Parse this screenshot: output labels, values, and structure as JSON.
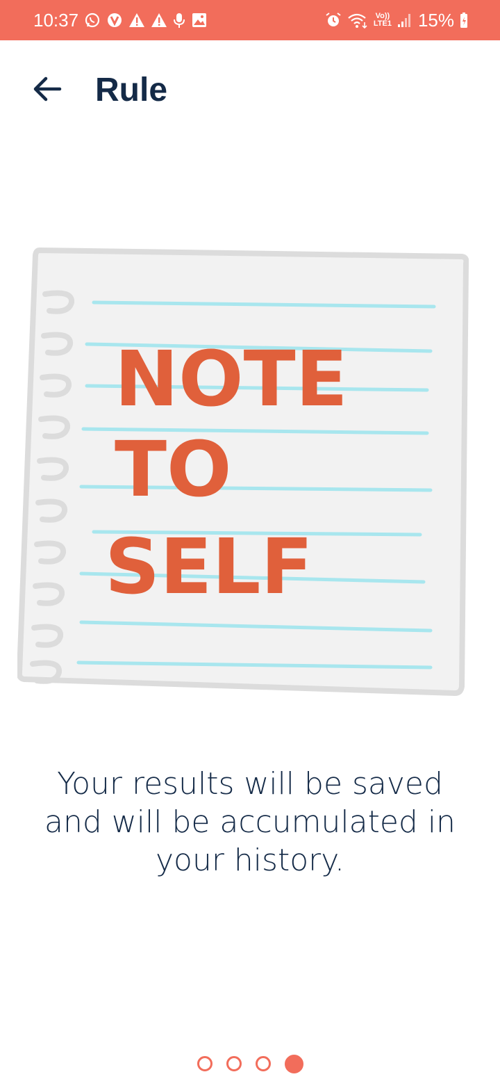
{
  "status_bar": {
    "time": "10:37",
    "left_icons": [
      "whatsapp-icon",
      "vpn-icon",
      "warning-icon",
      "warning-icon",
      "mic-icon",
      "image-icon"
    ],
    "right_icons": [
      "alarm-icon",
      "wifi-icon",
      "volte-icon",
      "signal-icon",
      "battery-icon"
    ],
    "volte_top": "Vo))",
    "volte_bottom": "LTE1",
    "battery": "15%",
    "background_color": "#f26d5b"
  },
  "header": {
    "title": "Rule",
    "back_icon": "arrow-left-icon"
  },
  "illustration": {
    "lines": [
      "NOTE",
      "TO",
      "SELF"
    ],
    "ink_color": "#e0603b",
    "rule_color": "#a8e6ee"
  },
  "message": {
    "text": "Your results will be saved and will be accumulated in your history."
  },
  "pager": {
    "count": 4,
    "active_index": 3,
    "color": "#f26d5b"
  }
}
